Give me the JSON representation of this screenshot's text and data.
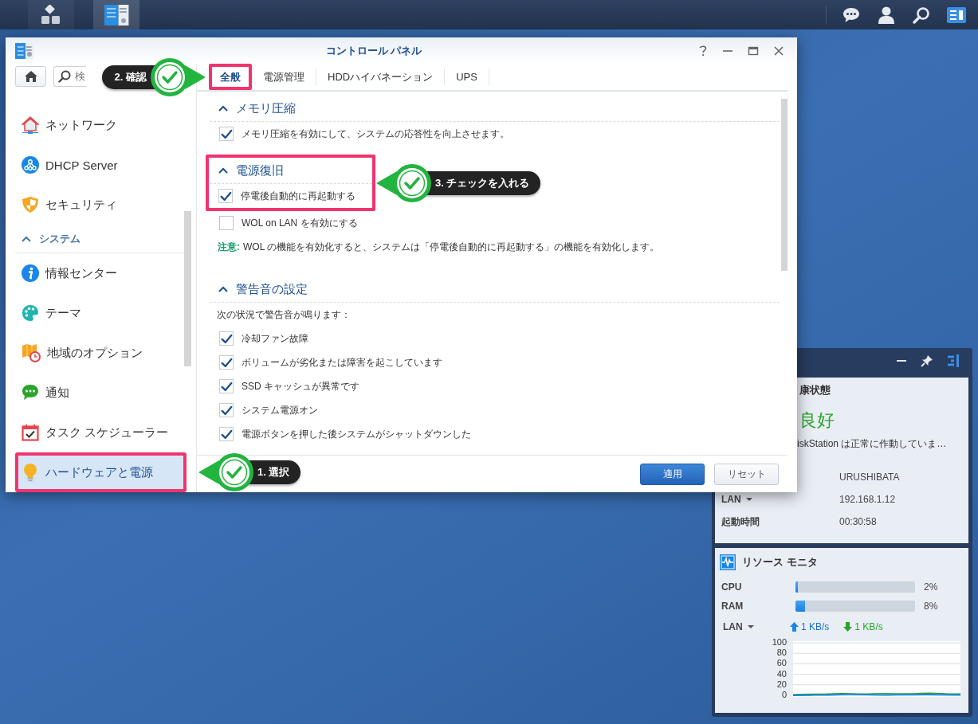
{
  "taskbar": {
    "apps": [
      {
        "kind": "main-menu",
        "selected": false
      },
      {
        "kind": "control-panel",
        "selected": true
      }
    ],
    "tray": [
      {
        "kind": "chat"
      },
      {
        "kind": "user"
      },
      {
        "kind": "search"
      },
      {
        "kind": "widgets",
        "selected": true
      }
    ]
  },
  "window": {
    "title": "コントロール パネル",
    "search": {
      "placeholder": "検"
    },
    "sidebar": {
      "items": [
        {
          "kind": "item",
          "label": "ネットワーク",
          "selected": false,
          "highlighted": false
        },
        {
          "kind": "item",
          "label": "DHCP Server",
          "selected": false,
          "highlighted": false
        },
        {
          "kind": "item",
          "label": "セキュリティ",
          "selected": false,
          "highlighted": false
        },
        {
          "kind": "header",
          "label": "システム",
          "expanded": true
        },
        {
          "kind": "item",
          "label": "情報センター",
          "selected": false,
          "highlighted": false
        },
        {
          "kind": "item",
          "label": "テーマ",
          "selected": false,
          "highlighted": false
        },
        {
          "kind": "item",
          "label": "地域のオプション",
          "selected": false,
          "highlighted": false
        },
        {
          "kind": "item",
          "label": "通知",
          "selected": false,
          "highlighted": false
        },
        {
          "kind": "item",
          "label": "タスク スケジューラー",
          "selected": false,
          "highlighted": false
        },
        {
          "kind": "item",
          "label": "ハードウェアと電源",
          "selected": true,
          "highlighted": true,
          "callout": "1. 選択"
        }
      ]
    },
    "tabs": [
      {
        "label": "全般",
        "selected": true,
        "highlighted": true,
        "callout": "2. 確認"
      },
      {
        "label": "電源管理",
        "selected": false,
        "highlighted": false
      },
      {
        "label": "HDDハイバネーション",
        "selected": false,
        "highlighted": false
      },
      {
        "label": "UPS",
        "selected": false,
        "highlighted": false
      }
    ],
    "sections": [
      {
        "title": "メモリ圧縮",
        "expanded": true,
        "highlighted": false,
        "rows": [
          {
            "kind": "checkbox",
            "label": "メモリ圧縮を有効にして、システムの応答性を向上させます。",
            "checked": true
          }
        ]
      },
      {
        "title": "電源復旧",
        "expanded": true,
        "highlighted": true,
        "callout": "3. チェックを入れる",
        "rows": [
          {
            "kind": "checkbox",
            "label": "停電後自動的に再起動する",
            "checked": true
          },
          {
            "kind": "checkbox",
            "label": "WOL on LAN を有効にする",
            "checked": false
          },
          {
            "kind": "note",
            "label": "注意:",
            "text": "WOL の機能を有効化すると、システムは「停電後自動的に再起動する」の機能を有効化します。"
          }
        ]
      },
      {
        "title": "警告音の設定",
        "expanded": true,
        "highlighted": false,
        "rows": [
          {
            "kind": "text",
            "text": "次の状況で警告音が鳴ります："
          },
          {
            "kind": "checkbox",
            "label": "冷却ファン故障",
            "checked": true
          },
          {
            "kind": "checkbox",
            "label": "ボリュームが劣化または障害を起こしています",
            "checked": true
          },
          {
            "kind": "checkbox",
            "label": "SSD キャッシュが異常です",
            "checked": true
          },
          {
            "kind": "checkbox",
            "label": "システム電源オン",
            "checked": true
          },
          {
            "kind": "checkbox",
            "label": "電源ボタンを押した後システムがシャットダウンした",
            "checked": true
          }
        ]
      }
    ],
    "buttons": [
      {
        "kind": "primary",
        "label": "適用"
      },
      {
        "kind": "secondary",
        "label": "リセット"
      }
    ]
  },
  "widgets": {
    "health": {
      "title": "康状態",
      "status": "良好",
      "message": "iskStation は正常に作動していま…",
      "rows": [
        {
          "value": "URUSHIBATA"
        },
        {
          "label": "LAN",
          "dropdown": true,
          "value": "192.168.1.12"
        },
        {
          "label": "起動時間",
          "value": "00:30:58"
        }
      ]
    },
    "resource_monitor": {
      "title": "リソース モニタ",
      "meters": [
        {
          "label": "CPU",
          "level": 0.02,
          "reading": "2%"
        },
        {
          "label": "RAM",
          "level": 0.08,
          "reading": "8%"
        }
      ],
      "network": {
        "label": "LAN",
        "dropdown": true,
        "upload": "1 KB/s",
        "download": "1 KB/s"
      },
      "graph_scale": [
        "100",
        "80",
        "60",
        "40",
        "20",
        "0"
      ]
    }
  }
}
